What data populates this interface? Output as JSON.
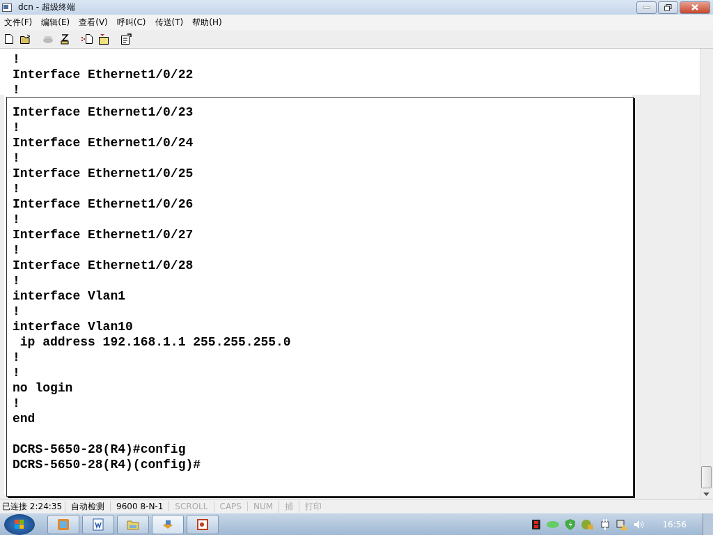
{
  "window": {
    "title": "dcn - 超级终端"
  },
  "menu": [
    "文件(F)",
    "编辑(E)",
    "查看(V)",
    "呼叫(C)",
    "传送(T)",
    "帮助(H)"
  ],
  "terminal": {
    "lines_above": [
      "!",
      "Interface Ethernet1/0/22",
      "!"
    ],
    "lines": [
      "Interface Ethernet1/0/23",
      "!",
      "Interface Ethernet1/0/24",
      "!",
      "Interface Ethernet1/0/25",
      "!",
      "Interface Ethernet1/0/26",
      "!",
      "Interface Ethernet1/0/27",
      "!",
      "Interface Ethernet1/0/28",
      "!",
      "interface Vlan1",
      "!",
      "interface Vlan10",
      " ip address 192.168.1.1 255.255.255.0",
      "!",
      "!",
      "no login",
      "!",
      "end"
    ],
    "prompt_lines": [
      "DCRS-5650-28(R4)#config",
      "DCRS-5650-28(R4)(config)#"
    ]
  },
  "status_bar": [
    {
      "text": "已连接 2:24:35",
      "disabled": false
    },
    {
      "text": "自动检测",
      "disabled": false
    },
    {
      "text": "9600 8-N-1",
      "disabled": false
    },
    {
      "text": "SCROLL",
      "disabled": true
    },
    {
      "text": "CAPS",
      "disabled": true
    },
    {
      "text": "NUM",
      "disabled": true
    },
    {
      "text": "捕",
      "disabled": true
    },
    {
      "text": "打印",
      "disabled": true
    }
  ],
  "taskbar": {
    "clock": "16:56"
  }
}
